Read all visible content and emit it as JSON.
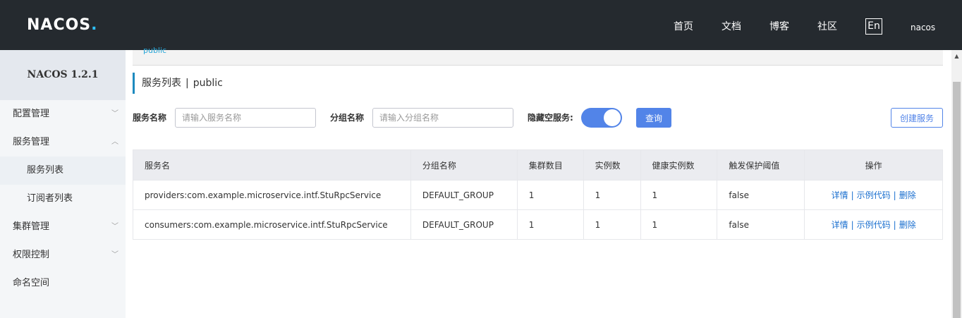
{
  "header": {
    "logo": "NACOS",
    "logo_dot": ".",
    "nav": [
      "首页",
      "文档",
      "博客",
      "社区"
    ],
    "lang": "En",
    "user": "nacos"
  },
  "sidebar": {
    "title": "NACOS 1.2.1",
    "items": [
      {
        "label": "配置管理",
        "chevron": "﹀"
      },
      {
        "label": "服务管理",
        "chevron": "︿"
      },
      {
        "label": "服务列表"
      },
      {
        "label": "订阅者列表"
      },
      {
        "label": "集群管理",
        "chevron": "﹀"
      },
      {
        "label": "权限控制",
        "chevron": "﹀"
      },
      {
        "label": "命名空间"
      }
    ]
  },
  "main": {
    "namespace_tab": "public",
    "page_title": "服务列表",
    "title_sep": "|",
    "namespace": "public",
    "search": {
      "service_label": "服务名称",
      "service_placeholder": "请输入服务名称",
      "group_label": "分组名称",
      "group_placeholder": "请输入分组名称",
      "hide_empty_label": "隐藏空服务:",
      "hide_empty_on": true,
      "query_button": "查询",
      "create_button": "创建服务"
    },
    "table": {
      "headers": [
        "服务名",
        "分组名称",
        "集群数目",
        "实例数",
        "健康实例数",
        "触发保护阈值",
        "操作"
      ],
      "rows": [
        {
          "name": "providers:com.example.microservice.intf.StuRpcService",
          "group": "DEFAULT_GROUP",
          "clusters": "1",
          "instances": "1",
          "healthy": "1",
          "threshold": "false",
          "ops": [
            "详情",
            "示例代码",
            "删除"
          ]
        },
        {
          "name": "consumers:com.example.microservice.intf.StuRpcService",
          "group": "DEFAULT_GROUP",
          "clusters": "1",
          "instances": "1",
          "healthy": "1",
          "threshold": "false",
          "ops": [
            "详情",
            "示例代码",
            "删除"
          ]
        }
      ],
      "op_sep": "|"
    }
  },
  "colors": {
    "header_bg": "#252a2f",
    "primary": "#5284e8",
    "link": "#1a6fcf"
  }
}
